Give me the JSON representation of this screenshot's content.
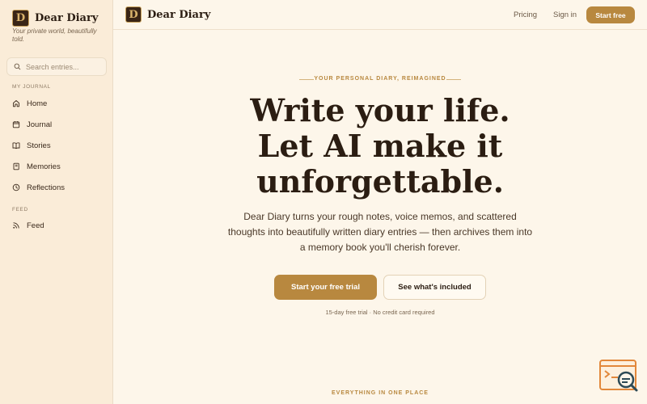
{
  "sidebar": {
    "brand_logo_letter": "D",
    "brand_name": "Dear Diary",
    "tagline": "Your private world, beautifully told.",
    "search_placeholder": "Search entries...",
    "sections": {
      "journal_label": "MY JOURNAL",
      "feed_label": "FEED"
    },
    "items": [
      {
        "label": "Home",
        "icon": "home-icon"
      },
      {
        "label": "Journal",
        "icon": "calendar-icon"
      },
      {
        "label": "Stories",
        "icon": "book-open-icon"
      },
      {
        "label": "Memories",
        "icon": "notebook-icon"
      },
      {
        "label": "Reflections",
        "icon": "clock-icon"
      },
      {
        "label": "Feed",
        "icon": "rss-icon"
      }
    ]
  },
  "topbar": {
    "brand_logo_letter": "D",
    "brand_name": "Dear Diary",
    "pricing_label": "Pricing",
    "signin_label": "Sign in",
    "start_free_label": "Start free"
  },
  "hero": {
    "eyebrow": "YOUR PERSONAL DIARY, REIMAGINED",
    "headline": [
      "Write your life.",
      "Let AI make it",
      "unforgettable."
    ],
    "subtext": "Dear Diary turns your rough notes, voice memos, and scattered thoughts into beautifully written diary entries — then archives them into a memory book you'll cherish forever.",
    "primary_cta": "Start your free trial",
    "secondary_cta": "See what's included",
    "fineprint": "15-day free trial · No credit card required",
    "next_section": "EVERYTHING IN ONE PLACE"
  },
  "colors": {
    "accent": "#b8883f",
    "background": "#fdf6ea",
    "sidebar_bg": "#faecd8",
    "text": "#2b1d12"
  }
}
